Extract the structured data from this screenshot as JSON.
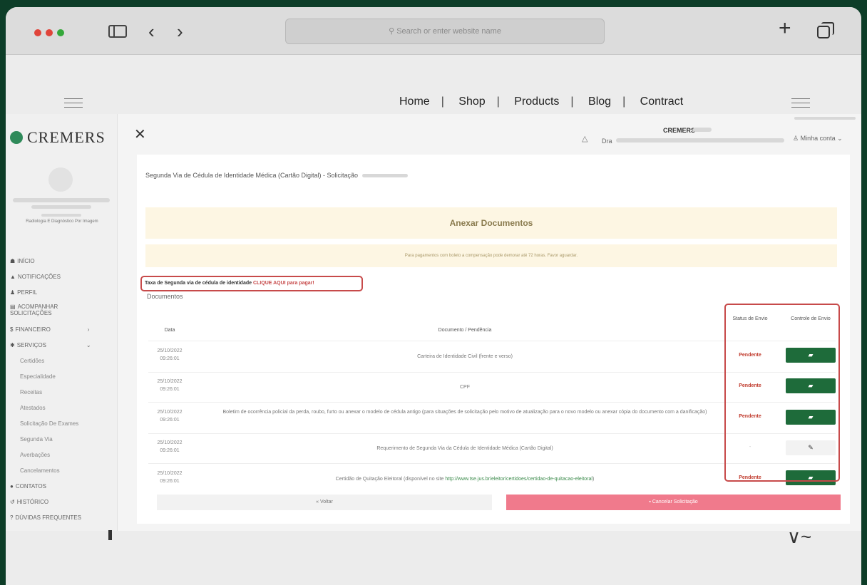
{
  "browser": {
    "url_placeholder": "Search or enter website name",
    "icons": [
      "sidebar-icon",
      "back-icon",
      "forward-icon",
      "plus-icon",
      "tabs-icon"
    ]
  },
  "site_nav": {
    "items": [
      "Home",
      "Shop",
      "Products",
      "Blog",
      "Contract"
    ]
  },
  "app": {
    "logo_text": "CREMERS",
    "specialty": "Radiologia E Diagnóstico Por Imagem",
    "menu": [
      {
        "label": "INÍCIO",
        "icon": "☗"
      },
      {
        "label": "NOTIFICAÇÕES",
        "icon": "▲"
      },
      {
        "label": "PERFIL",
        "icon": "♟"
      },
      {
        "label": "ACOMPANHAR SOLICITAÇÕES",
        "icon": "▤"
      },
      {
        "label": "FINANCEIRO",
        "icon": "$"
      },
      {
        "label": "SERVIÇOS",
        "icon": "✱"
      }
    ],
    "submenu": [
      "Certidões",
      "Especialidade",
      "Receitas",
      "Atestados",
      "Solicitação De Exames",
      "Segunda Via",
      "Averbações",
      "Cancelamentos"
    ],
    "menu_bottom": [
      {
        "label": "CONTATOS",
        "icon": "●"
      },
      {
        "label": "HISTÓRICO",
        "icon": "↺"
      },
      {
        "label": "DÚVIDAS FREQUENTES",
        "icon": "?"
      }
    ],
    "header": {
      "cremers_label": "CREMERS",
      "dra_label": "Dra",
      "account_label": "Minha conta"
    },
    "page_title": "Segunda Via de Cédula de Identidade Médica (Cartão Digital) - Solicitação",
    "banner_title": "Anexar Documentos",
    "notice": "Para pagamentos com boleto a compensação pode demorar até 72 horas. Favor aguardar.",
    "fee": {
      "prefix": "Taxa de Segunda via de cédula de identidade ",
      "link": "CLIQUE AQUI",
      "suffix": " para pagar!"
    },
    "docs_label": "Documentos",
    "table": {
      "headers": {
        "date": "Data",
        "doc": "Documento / Pendência",
        "status": "Status de Envio",
        "control": "Controle de Envio"
      },
      "rows": [
        {
          "date": "25/10/2022",
          "time": "09:26:01",
          "doc": "Carteira de Identidade Civil (frente e verso)",
          "status": "Pendente",
          "control": "folder"
        },
        {
          "date": "25/10/2022",
          "time": "09:26:01",
          "doc": "CPF",
          "status": "Pendente",
          "control": "folder"
        },
        {
          "date": "25/10/2022",
          "time": "09:26:01",
          "doc": "Boletim de ocorrência policial da perda, roubo, furto ou anexar o modelo de cédula antigo (para situações de solicitação pelo motivo de atualização para o novo modelo ou anexar cópia do documento com a danificação)",
          "status": "Pendente",
          "control": "folder"
        },
        {
          "date": "25/10/2022",
          "time": "09:26:01",
          "doc": "Requerimento de Segunda Via da Cédula de Identidade Médica (Cartão Digital)",
          "status": "-",
          "control": "edit"
        },
        {
          "date": "25/10/2022",
          "time": "09:26:01",
          "doc": "Certidão de Quitação Eleitoral (disponível no site ",
          "doc_link": "http://www.tse.jus.br/eleitor/certidoes/certidao-de-quitacao-eleitoral",
          "doc_suffix": ")",
          "status": "Pendente",
          "control": "folder"
        }
      ]
    },
    "buttons": {
      "back": "« Voltar",
      "cancel": "Cancelar Solicitação"
    }
  },
  "colors": {
    "brand_green": "#1e6b3a",
    "pending_red": "#c0392b",
    "cancel_pink": "#f07a8c",
    "highlight": "#c74a4a"
  }
}
